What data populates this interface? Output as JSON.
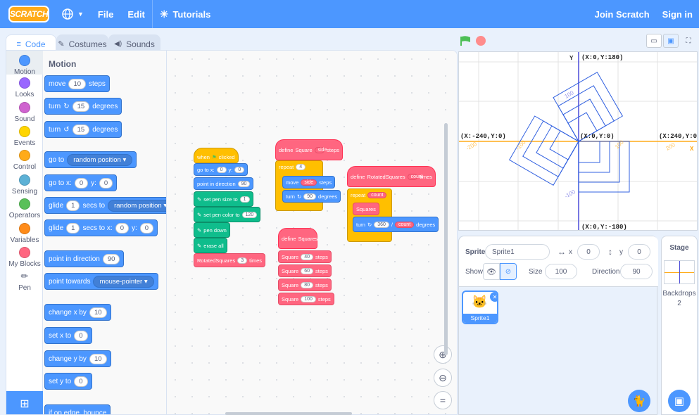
{
  "menu": {
    "logo": "SCRATCH",
    "file": "File",
    "edit": "Edit",
    "tutorials": "Tutorials",
    "join": "Join Scratch",
    "signin": "Sign in"
  },
  "tabs": {
    "code": "Code",
    "costumes": "Costumes",
    "sounds": "Sounds"
  },
  "categories": [
    {
      "label": "Motion",
      "color": "#4c97ff"
    },
    {
      "label": "Looks",
      "color": "#9966ff"
    },
    {
      "label": "Sound",
      "color": "#cf63cf"
    },
    {
      "label": "Events",
      "color": "#ffd500"
    },
    {
      "label": "Control",
      "color": "#ffab19"
    },
    {
      "label": "Sensing",
      "color": "#5cb1d6"
    },
    {
      "label": "Operators",
      "color": "#59c059"
    },
    {
      "label": "Variables",
      "color": "#ff8c1a"
    },
    {
      "label": "My Blocks",
      "color": "#ff6680"
    },
    {
      "label": "Pen",
      "color": "#0fbd8c"
    }
  ],
  "palette": {
    "title": "Motion",
    "move": {
      "pre": "move",
      "val": "10",
      "post": "steps"
    },
    "turn_right": {
      "pre": "turn",
      "val": "15",
      "post": "degrees"
    },
    "turn_left": {
      "pre": "turn",
      "val": "15",
      "post": "degrees"
    },
    "goto": {
      "pre": "go to",
      "drop": "random position"
    },
    "gotoxy": {
      "pre": "go to x:",
      "x": "0",
      "mid": "y:",
      "y": "0"
    },
    "glide": {
      "pre": "glide",
      "val": "1",
      "mid": "secs to",
      "drop": "random position"
    },
    "glidexy": {
      "pre": "glide",
      "val": "1",
      "mid": "secs to x:",
      "x": "0",
      "ylabel": "y:",
      "y": "0"
    },
    "point_dir": {
      "pre": "point in direction",
      "val": "90"
    },
    "point_towards": {
      "pre": "point towards",
      "drop": "mouse-pointer"
    },
    "changex": {
      "pre": "change x by",
      "val": "10"
    },
    "setx": {
      "pre": "set x to",
      "val": "0"
    },
    "changey": {
      "pre": "change y by",
      "val": "10"
    },
    "sety": {
      "pre": "set y to",
      "val": "0"
    },
    "bounce": {
      "pre": "if on edge, bounce"
    }
  },
  "scripts": {
    "main": {
      "hat": "when",
      "hat2": "clicked",
      "goto": "go to x:",
      "gx": "0",
      "gy_label": "y:",
      "gy": "0",
      "point": "point in direction",
      "pdir": "90",
      "pensize": "set pen size to",
      "psize": "1",
      "pencolor": "set pen color to",
      "pcolor": "120",
      "pendown": "pen down",
      "erase": "erase all",
      "call": "RotatedSquares",
      "callval": "3",
      "calltimes": "times"
    },
    "square": {
      "define": "define",
      "name": "Square",
      "arg": "side",
      "steps": "steps",
      "repeat": "repeat",
      "rval": "4",
      "move": "move",
      "marg": "side",
      "msteps": "steps",
      "turn": "turn",
      "tval": "90",
      "tdeg": "degrees"
    },
    "squares": {
      "define": "define",
      "name": "Squares",
      "calls": [
        {
          "name": "Square",
          "val": "40",
          "steps": "steps"
        },
        {
          "name": "Square",
          "val": "60",
          "steps": "steps"
        },
        {
          "name": "Square",
          "val": "80",
          "steps": "steps"
        },
        {
          "name": "Square",
          "val": "100",
          "steps": "steps"
        }
      ]
    },
    "rotated": {
      "define": "define",
      "name": "RotatedSquares",
      "arg": "count",
      "times": "times",
      "repeat": "repeat",
      "rarg": "count",
      "call": "Squares",
      "turn": "turn",
      "tval": "360",
      "targ": "count",
      "tdeg": "degrees"
    }
  },
  "stage_labels": {
    "y_axis": "Y",
    "x_axis": "X",
    "top": "(X:0,Y:180)",
    "bottom": "(X:0,Y:-180)",
    "left": "(X:-240,Y:0)",
    "right": "(X:240,Y:0)",
    "origin": "(X:0,Y:0)",
    "t100": "100",
    "t200": "200",
    "tm100": "-100",
    "tm200": "-200",
    "tr100": "100",
    "tr200": "200",
    "tl200": "-200"
  },
  "sprite_info": {
    "sprite_label": "Sprite",
    "sprite_name": "Sprite1",
    "x_label": "x",
    "x": "0",
    "y_label": "y",
    "y": "0",
    "show_label": "Show",
    "size_label": "Size",
    "size": "100",
    "direction_label": "Direction",
    "direction": "90"
  },
  "sprite_list": [
    {
      "name": "Sprite1"
    }
  ],
  "stage_panel": {
    "title": "Stage",
    "backdrops_label": "Backdrops",
    "backdrops": "2"
  },
  "colors": {
    "accent": "#4c97ff",
    "topbar": "#4c97ff",
    "myblocks": "#ff6680",
    "pen": "#0fbd8c",
    "control": "#ffab19"
  }
}
